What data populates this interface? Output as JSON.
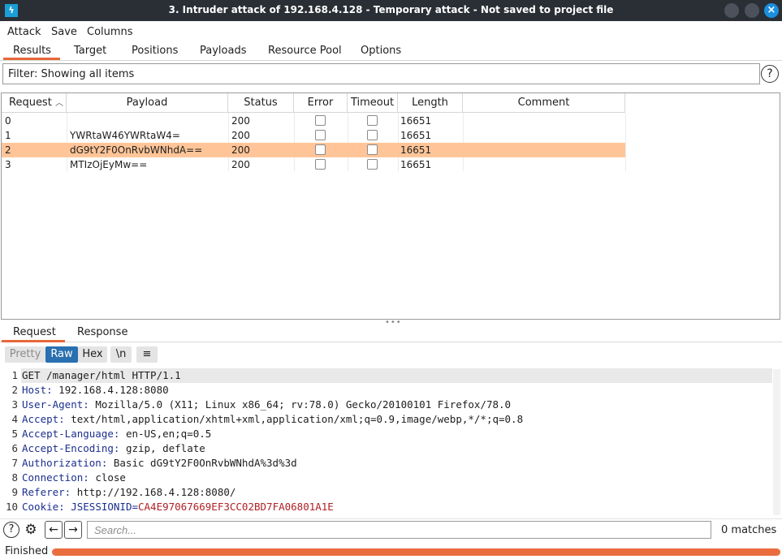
{
  "window": {
    "title": "3. Intruder attack of 192.168.4.128 - Temporary attack - Not saved to project file",
    "app_icon": "burp-bolt-icon"
  },
  "menu": [
    "Attack",
    "Save",
    "Columns"
  ],
  "tabs": [
    "Results",
    "Target",
    "Positions",
    "Payloads",
    "Resource Pool",
    "Options"
  ],
  "active_tab": "Results",
  "filter": {
    "text": "Filter: Showing all items",
    "help": "?"
  },
  "table": {
    "headers": [
      "Request",
      "Payload",
      "Status",
      "Error",
      "Timeout",
      "Length",
      "Comment"
    ],
    "sort_indicator": "^",
    "rows": [
      {
        "request": "0",
        "payload": "",
        "status": "200",
        "error": false,
        "timeout": false,
        "length": "16651",
        "comment": ""
      },
      {
        "request": "1",
        "payload": "YWRtaW46YWRtaW4=",
        "status": "200",
        "error": false,
        "timeout": false,
        "length": "16651",
        "comment": ""
      },
      {
        "request": "2",
        "payload": "dG9tY2F0OnRvbWNhdA==",
        "status": "200",
        "error": false,
        "timeout": false,
        "length": "16651",
        "comment": "",
        "selected": true
      },
      {
        "request": "3",
        "payload": "MTIzOjEyMw==",
        "status": "200",
        "error": false,
        "timeout": false,
        "length": "16651",
        "comment": ""
      }
    ]
  },
  "detail_tabs": [
    "Request",
    "Response"
  ],
  "active_detail_tab": "Request",
  "view_buttons": {
    "pretty": "Pretty",
    "raw": "Raw",
    "hex": "Hex",
    "newline": "\\n",
    "wrap": "≡"
  },
  "editor": {
    "lines": [
      {
        "num": "1",
        "text": "GET /manager/html HTTP/1.1"
      },
      {
        "num": "2",
        "name": "Host:",
        "value": " 192.168.4.128:8080"
      },
      {
        "num": "3",
        "name": "User-Agent:",
        "value": " Mozilla/5.0 (X11; Linux x86_64; rv:78.0) Gecko/20100101 Firefox/78.0"
      },
      {
        "num": "4",
        "name": "Accept:",
        "value": " text/html,application/xhtml+xml,application/xml;q=0.9,image/webp,*/*;q=0.8"
      },
      {
        "num": "5",
        "name": "Accept-Language:",
        "value": " en-US,en;q=0.5"
      },
      {
        "num": "6",
        "name": "Accept-Encoding:",
        "value": " gzip, deflate"
      },
      {
        "num": "7",
        "name": "Authorization:",
        "value": " Basic dG9tY2F0OnRvbWNhdA%3d%3d"
      },
      {
        "num": "8",
        "name": "Connection:",
        "value": " close"
      },
      {
        "num": "9",
        "name": "Referer:",
        "value": " http://192.168.4.128:8080/"
      },
      {
        "num": "10",
        "name": "Cookie:",
        "cookie_key": " JSESSIONID=",
        "cookie_value": "CA4E97067669EF3CC02BD7FA06801A1E"
      }
    ]
  },
  "search": {
    "placeholder": "Search...",
    "matches": "0 matches"
  },
  "status": {
    "text": "Finished",
    "progress": 1.0
  },
  "colors": {
    "accent": "#e8673a",
    "selected_row": "#ffc598",
    "raw_button": "#2a6fb0",
    "header_name": "#1b2f8f",
    "cookie_value": "#b02025"
  }
}
